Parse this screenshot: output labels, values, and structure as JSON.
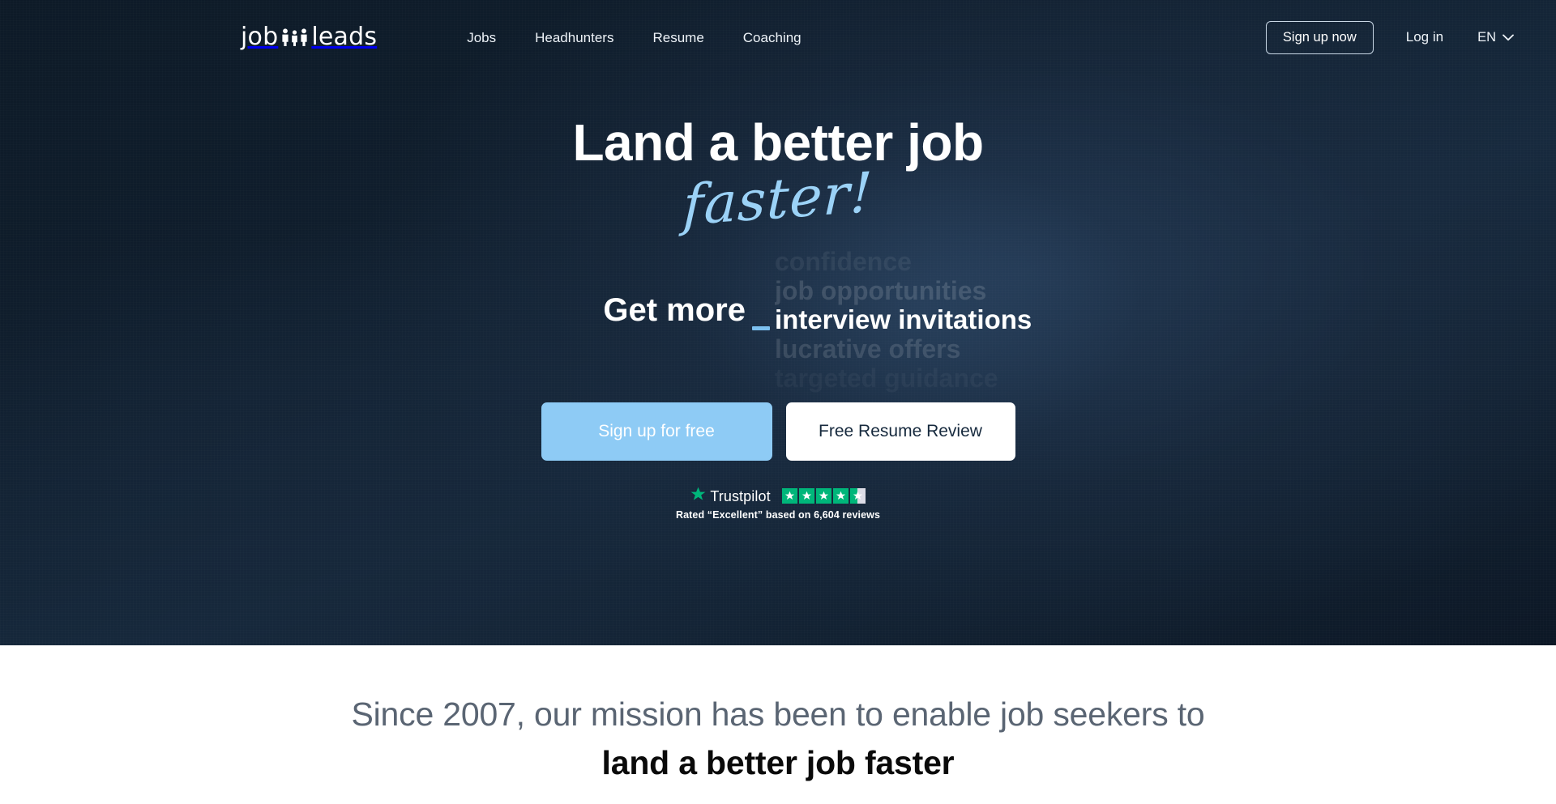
{
  "colors": {
    "hero_bg_dark": "#0d1a27",
    "hero_bg_mid": "#16293d",
    "accent_blue": "#8ecbf5",
    "script_blue": "#9bd2f7",
    "caret_blue": "#7cc0ef",
    "trustpilot_green": "#00b67a",
    "mission_gray": "#5a6573",
    "white": "#ffffff"
  },
  "header": {
    "logo": {
      "word_left": "job",
      "word_right": "leads",
      "icon": "three-people-icon"
    },
    "nav": [
      {
        "label": "Jobs",
        "name": "nav-jobs"
      },
      {
        "label": "Headhunters",
        "name": "nav-headhunters"
      },
      {
        "label": "Resume",
        "name": "nav-resume"
      },
      {
        "label": "Coaching",
        "name": "nav-coaching"
      }
    ],
    "signup_now_label": "Sign up now",
    "login_label": "Log in",
    "language": "EN",
    "language_chevron": "chevron-down-icon"
  },
  "hero": {
    "headline_line1": "Land a better job",
    "headline_script": "faster!",
    "claim_static": "Get more",
    "claim_items": [
      "confidence",
      "job opportunities",
      "interview invitations",
      "lucrative offers",
      "targeted guidance"
    ],
    "claim_active_index": 2,
    "cta_primary": "Sign up for free",
    "cta_secondary": "Free Resume Review"
  },
  "trustpilot": {
    "brand_name": "Trustpilot",
    "star_icon": "star-icon",
    "rating_stars": 4.5,
    "full_stars": 4,
    "has_half_star": true,
    "caption": "Rated “Excellent” based on 6,604 reviews"
  },
  "mission": {
    "line1": "Since 2007, our mission has been to enable job seekers to",
    "line2": "land a better job faster"
  }
}
